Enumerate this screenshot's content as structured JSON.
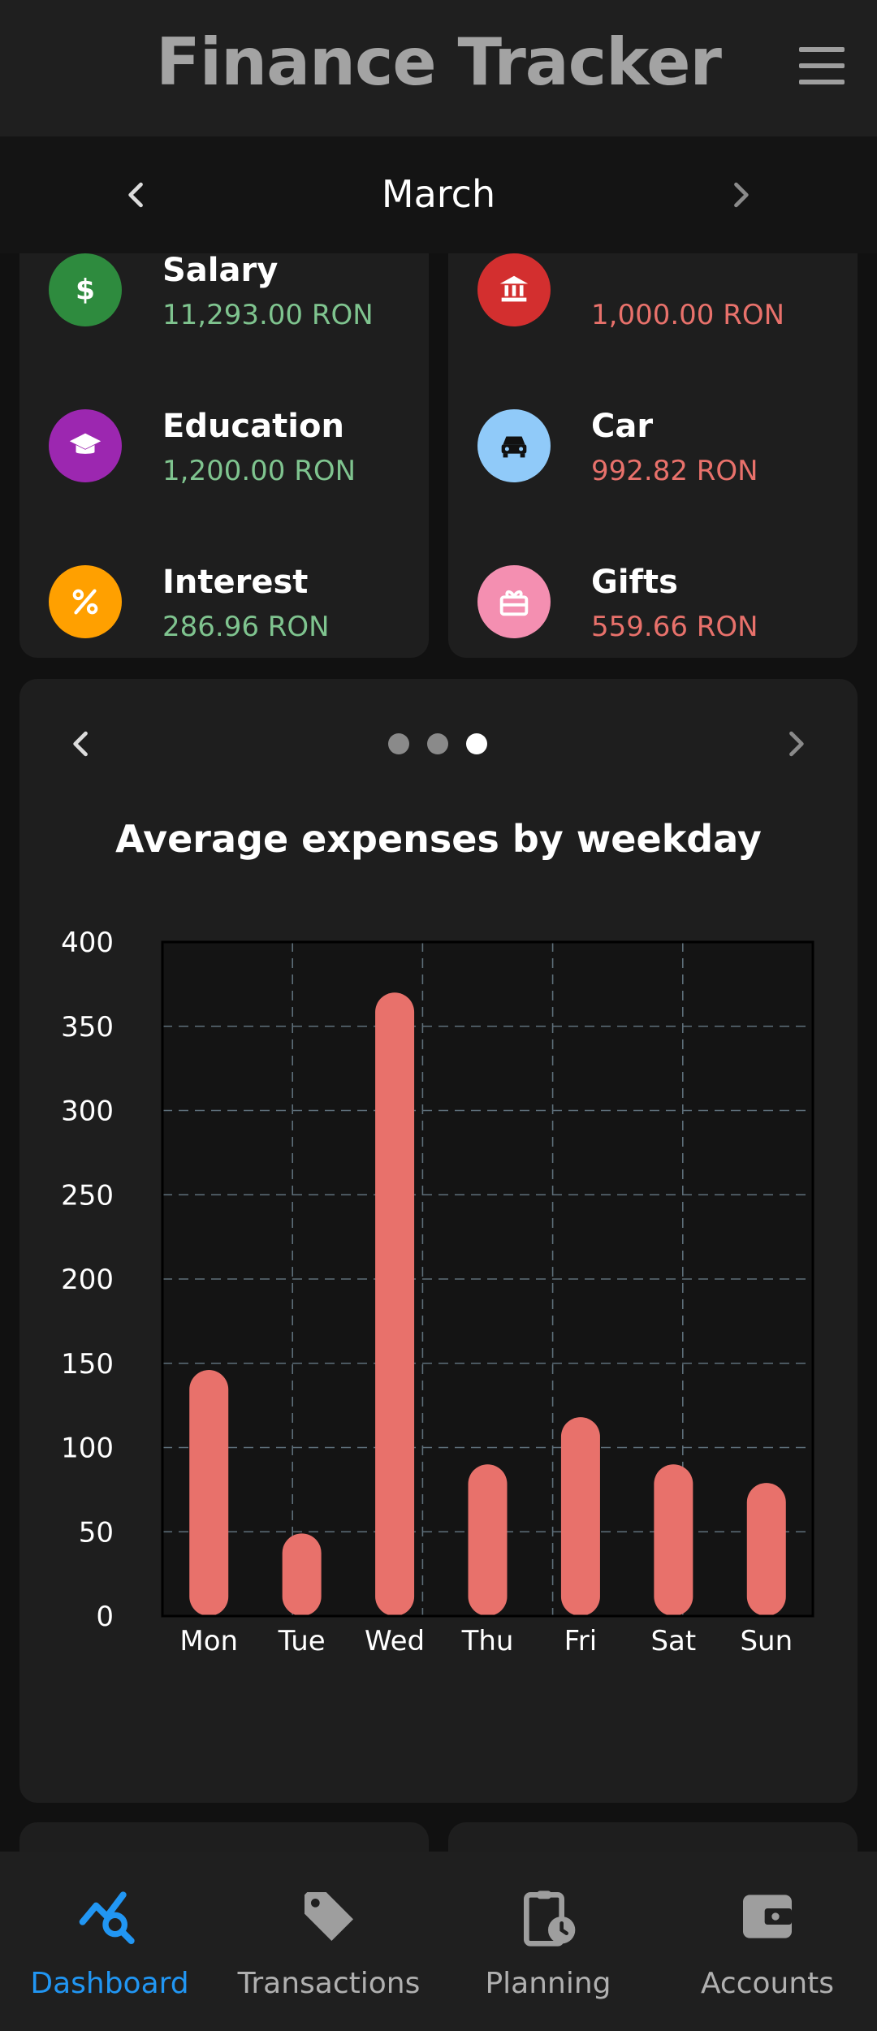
{
  "app": {
    "title": "Finance Tracker"
  },
  "month_nav": {
    "label": "March"
  },
  "income_card": {
    "items": [
      {
        "name": "Salary",
        "amount": "11,293.00 RON",
        "icon": "dollar-icon",
        "color": "#2e8b3e"
      },
      {
        "name": "Education",
        "amount": "1,200.00 RON",
        "icon": "graduation-cap-icon",
        "color": "#9c27b0"
      },
      {
        "name": "Interest",
        "amount": "286.96 RON",
        "icon": "percent-icon",
        "color": "#ffa000"
      }
    ]
  },
  "expense_card": {
    "items": [
      {
        "name": "",
        "amount": "1,000.00 RON",
        "icon": "bank-icon",
        "color": "#d32f2f"
      },
      {
        "name": "Car",
        "amount": "992.82 RON",
        "icon": "car-icon",
        "color": "#90caf9"
      },
      {
        "name": "Gifts",
        "amount": "559.66 RON",
        "icon": "gift-icon",
        "color": "#f48fb1"
      }
    ]
  },
  "carousel": {
    "page_count": 3,
    "active_index": 2
  },
  "chart_data": {
    "type": "bar",
    "title": "Average expenses by weekday",
    "categories": [
      "Mon",
      "Tue",
      "Wed",
      "Thu",
      "Fri",
      "Sat",
      "Sun"
    ],
    "values": [
      146,
      49,
      370,
      90,
      118,
      90,
      79
    ],
    "yticks": [
      "0",
      "50",
      "100",
      "150",
      "200",
      "250",
      "300",
      "350",
      "400"
    ],
    "ylim": [
      0,
      400
    ],
    "bar_color": "#e8716b",
    "grid": true
  },
  "bottom_nav": {
    "items": [
      {
        "label": "Dashboard",
        "icon": "chart-search-icon",
        "active": true
      },
      {
        "label": "Transactions",
        "icon": "tag-icon",
        "active": false
      },
      {
        "label": "Planning",
        "icon": "clipboard-clock-icon",
        "active": false
      },
      {
        "label": "Accounts",
        "icon": "wallet-icon",
        "active": false
      }
    ]
  },
  "colors": {
    "accent": "#2196f3",
    "card": "#1e1e1e",
    "background": "#111111"
  }
}
